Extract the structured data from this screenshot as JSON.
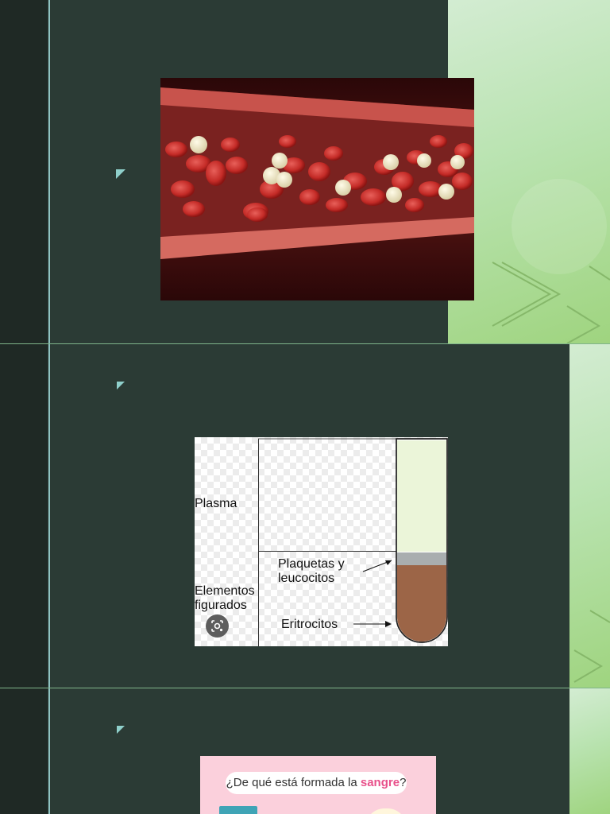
{
  "slides": [
    {
      "id": 1,
      "image": {
        "kind": "photo",
        "subject": "blood vessel with red and white blood cells",
        "colors": {
          "background": "#3a0c0e",
          "vessel": "#c8534c",
          "red_cell": "#c9302c",
          "white_cell": "#f2ecd0"
        }
      }
    },
    {
      "id": 2,
      "diagram": {
        "labels": {
          "plasma": "Plasma",
          "formed_elements_line1": "Elementos",
          "formed_elements_line2": "figurados",
          "platelets_line1": "Plaquetas y",
          "platelets_line2": "leucocitos",
          "erythrocytes": "Eritrocitos"
        },
        "icons": [
          "visual-search-icon"
        ],
        "colors": {
          "plasma_layer": "#ebf5d9",
          "buffy_coat": "#a9aeaf",
          "erythrocyte_layer": "#9c6547"
        }
      }
    },
    {
      "id": 3,
      "infographic": {
        "title_before": "¿De qué está formada la ",
        "title_accent": "sangre",
        "title_after": "?",
        "colors": {
          "background": "#fbd0dc",
          "accent": "#e8508a"
        }
      }
    }
  ],
  "theme": {
    "slide_background": "#2b3b35",
    "left_band": "#1f2925",
    "accent_line": "#8fc3c2",
    "bullet": "#8fd0cb"
  }
}
